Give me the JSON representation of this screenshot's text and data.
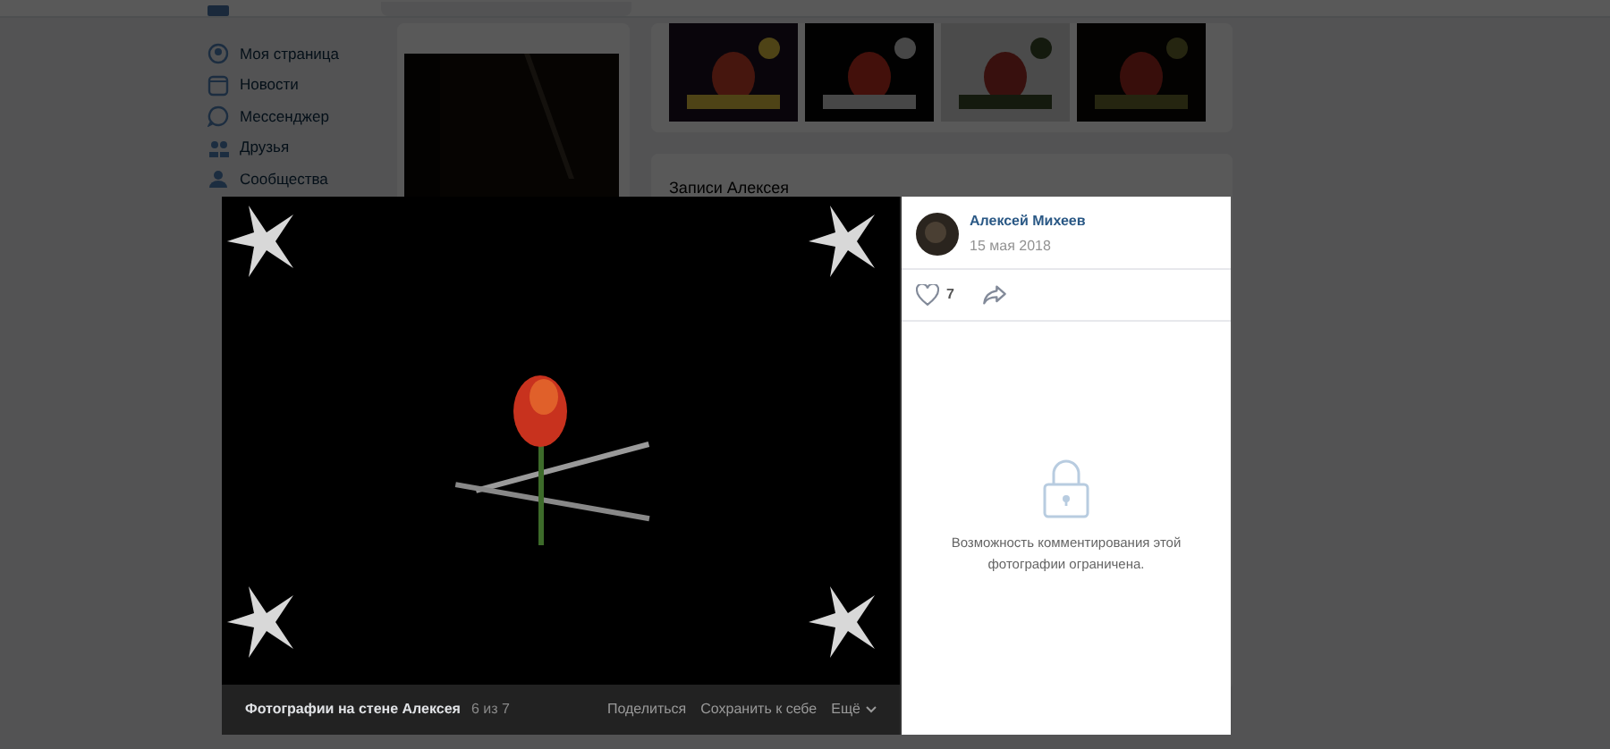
{
  "sidebar": {
    "items": [
      {
        "label": "Моя страница"
      },
      {
        "label": "Новости"
      },
      {
        "label": "Мессенджер"
      },
      {
        "label": "Друзья"
      },
      {
        "label": "Сообщества"
      }
    ]
  },
  "wall": {
    "title": "Записи Алексея"
  },
  "viewer": {
    "author": "Алексей Михеев",
    "date": "15 мая 2018",
    "likes": "7",
    "comments_notice": "Возможность комментирования этой фотографии ограничена.",
    "album": "Фотографии на стене Алексея",
    "counter": "6 из 7",
    "actions": [
      "Поделиться",
      "Сохранить к себе",
      "Ещё"
    ]
  }
}
